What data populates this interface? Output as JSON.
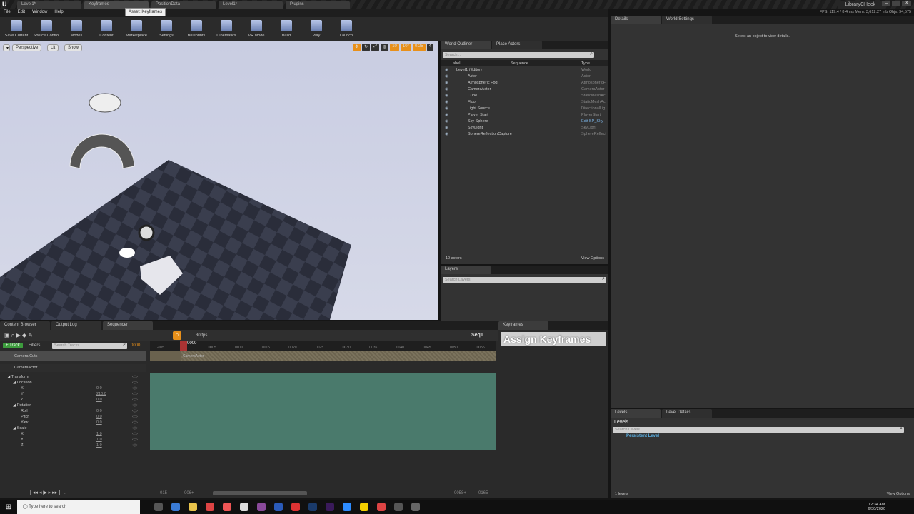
{
  "window": {
    "doc_tabs": [
      "Level1*",
      "Keyframes",
      "PositionData",
      "Level1*",
      "Plugins"
    ],
    "tooltip": "Asset: Keyframes",
    "project": "LibraryCHeck",
    "controls": [
      "–",
      "□",
      "X"
    ],
    "stats": "FPS: 119.4  / 8.4 ms  Mem: 3,612.27 mb  Objs: 94,575"
  },
  "menu": [
    "File",
    "Edit",
    "Window",
    "Help"
  ],
  "toolbar": [
    "Save Current",
    "Source Control",
    "Modes",
    "Content",
    "Marketplace",
    "Settings",
    "Blueprints",
    "Cinematics",
    "VR Mode",
    "Build",
    "Play",
    "Launch"
  ],
  "viewport": {
    "perspective": "Perspective",
    "lit": "Lit",
    "show": "Show",
    "grid_snap": "10",
    "rot_snap": "10°",
    "scale_snap": "0.25",
    "cam_speed": "4"
  },
  "outliner": {
    "tabs": [
      "World Outliner",
      "Place Actors"
    ],
    "search_placeholder": "Search...",
    "columns": [
      "Label",
      "Sequence",
      "Type"
    ],
    "rows": [
      {
        "label": "Level1 (Editor)",
        "type": "World"
      },
      {
        "label": "Actor",
        "type": "Actor"
      },
      {
        "label": "Atmospheric Fog",
        "type": "AtmosphericF"
      },
      {
        "label": "CameraActor",
        "type": "CameraActor"
      },
      {
        "label": "Cube",
        "type": "StaticMeshAc"
      },
      {
        "label": "Floor",
        "type": "StaticMeshAc"
      },
      {
        "label": "Light Source",
        "type": "DirectionalLig"
      },
      {
        "label": "Player Start",
        "type": "PlayerStart"
      },
      {
        "label": "Sky Sphere",
        "type": "Edit BP_Sky"
      },
      {
        "label": "SkyLight",
        "type": "SkyLight"
      },
      {
        "label": "SphereReflectionCapture",
        "type": "SphereReflect"
      }
    ],
    "count": "10 actors",
    "view_options": "View Options"
  },
  "layers": {
    "tab": "Layers",
    "search_placeholder": "Search Layers"
  },
  "details": {
    "tabs": [
      "Details",
      "World Settings"
    ],
    "empty": "Select an object to view details."
  },
  "levels": {
    "tabs": [
      "Levels",
      "Level Details"
    ],
    "menu": "Levels",
    "search_placeholder": "Search Levels",
    "item": "Persistent Level",
    "count": "1 levels",
    "view_options": "View Options"
  },
  "sequencer": {
    "tabs": [
      "Content Browser",
      "Output Log",
      "Sequencer"
    ],
    "fps": "30 fps",
    "seq_name": "Seq1",
    "track_btn": "Track",
    "filters": "Filters",
    "search_placeholder": "Search Tracks",
    "current_frame": "0000",
    "playhead": "0000",
    "ruler": [
      "-005",
      "0005",
      "0010",
      "0015",
      "0020",
      "0025",
      "0030",
      "0035",
      "0040",
      "0045",
      "0050",
      "0055"
    ],
    "camera_cuts": "Camera Cuts",
    "camera_section": "CameraActor",
    "actor": "CameraActor",
    "tracks": [
      {
        "name": "Transform",
        "lvl": 0
      },
      {
        "name": "Location",
        "lvl": 1
      },
      {
        "name": "X",
        "lvl": 2,
        "value": "0.0"
      },
      {
        "name": "Y",
        "lvl": 2,
        "value": "210.0"
      },
      {
        "name": "Z",
        "lvl": 2,
        "value": "0.0"
      },
      {
        "name": "Rotation",
        "lvl": 1
      },
      {
        "name": "Roll",
        "lvl": 2,
        "value": "0.0"
      },
      {
        "name": "Pitch",
        "lvl": 2,
        "value": "0.0"
      },
      {
        "name": "Yaw",
        "lvl": 2,
        "value": "0.0"
      },
      {
        "name": "Scale",
        "lvl": 1
      },
      {
        "name": "X",
        "lvl": 2,
        "value": "1.0"
      },
      {
        "name": "Y",
        "lvl": 2,
        "value": "1.0"
      },
      {
        "name": "Z",
        "lvl": 2,
        "value": "1.0"
      }
    ],
    "range": {
      "start": "-015",
      "view_start": "-006+",
      "view_end": "0058+",
      "end": "0165"
    }
  },
  "keyframes": {
    "tab": "Keyframes",
    "button": "Assign Keyframes"
  },
  "taskbar": {
    "search_placeholder": "Type here to search",
    "time": "12:34 AM",
    "date": "6/30/2020"
  },
  "colors": {
    "accent": "#e8901a",
    "section": "#4a7a6c",
    "link": "#5aaee0"
  }
}
